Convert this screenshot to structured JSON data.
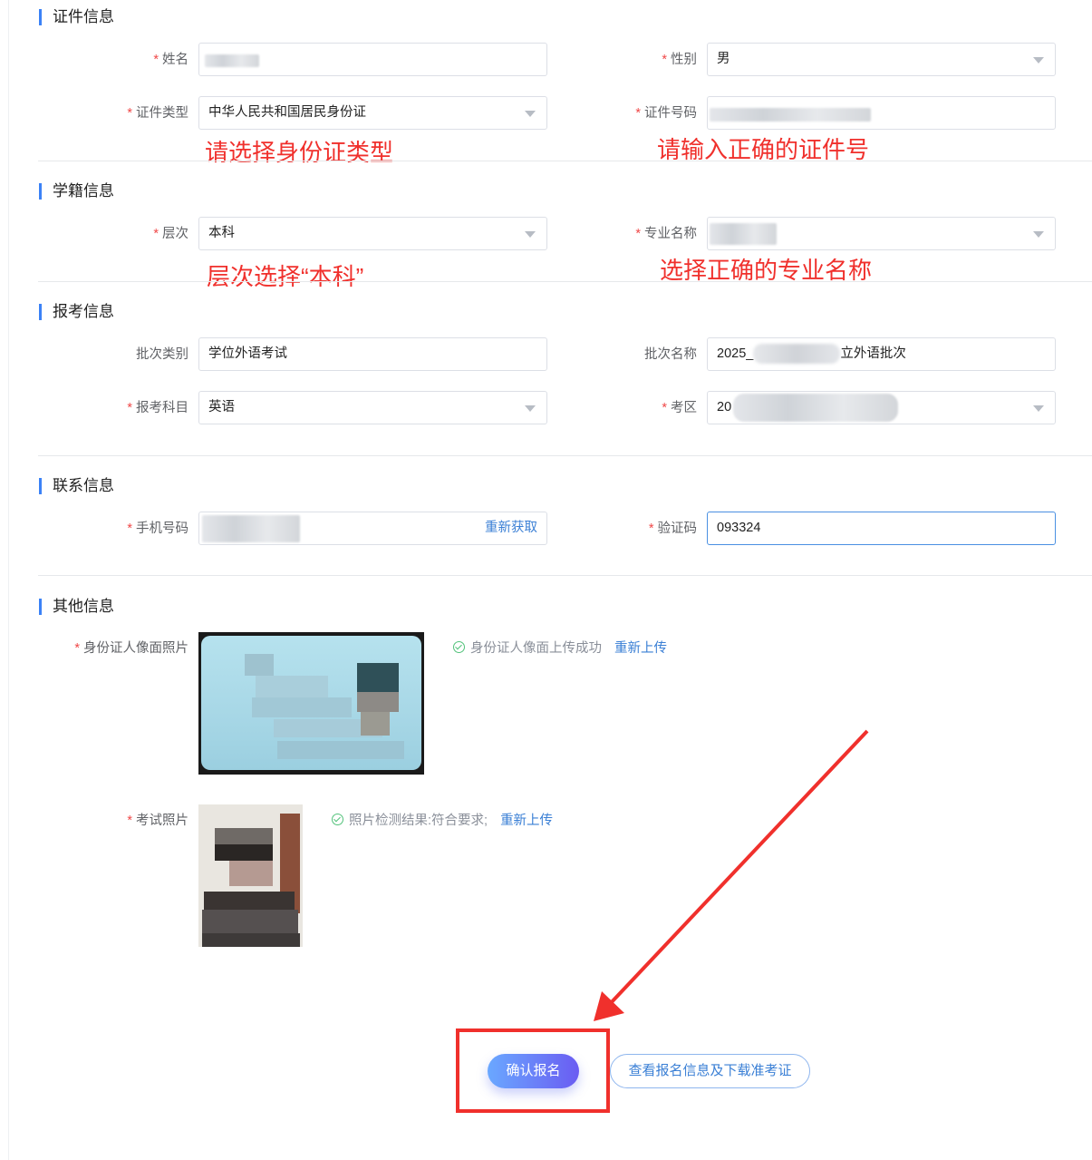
{
  "sections": {
    "id_info": "证件信息",
    "school_info": "学籍信息",
    "exam_info": "报考信息",
    "contact_info": "联系信息",
    "other_info": "其他信息"
  },
  "required_mark": "*",
  "fields": {
    "name_label": "姓名",
    "gender_label": "性别",
    "gender_value": "男",
    "id_type_label": "证件类型",
    "id_type_value": "中华人民共和国居民身份证",
    "id_number_label": "证件号码",
    "level_label": "层次",
    "level_value": "本科",
    "major_label": "专业名称",
    "batch_type_label": "批次类别",
    "batch_type_value": "学位外语考试",
    "batch_name_label": "批次名称",
    "batch_name_prefix": "2025_",
    "batch_name_suffix": "立外语批次",
    "subject_label": "报考科目",
    "subject_value": "英语",
    "area_label": "考区",
    "area_prefix": "20",
    "phone_label": "手机号码",
    "refetch_label": "重新获取",
    "code_label": "验证码",
    "code_value": "093324",
    "id_photo_label": "身份证人像面照片",
    "exam_photo_label": "考试照片"
  },
  "annotations": {
    "id_type": "请选择身份证类型",
    "id_number": "请输入正确的证件号",
    "level": "层次选择“本科”",
    "major": "选择正确的专业名称"
  },
  "status": {
    "id_photo_status": "身份证人像面上传成功",
    "id_photo_reupload": "重新上传",
    "exam_photo_status": "照片检测结果:符合要求;",
    "exam_photo_reupload": "重新上传"
  },
  "buttons": {
    "confirm": "确认报名",
    "view": "查看报名信息及下载准考证"
  },
  "colors": {
    "accent": "#3b82f6",
    "annotation_red": "#f0302c",
    "required": "#f04848",
    "link": "#3a7fd5"
  },
  "icons": [
    "caret-down-icon",
    "check-circle-icon",
    "arrow-annotation-icon"
  ]
}
